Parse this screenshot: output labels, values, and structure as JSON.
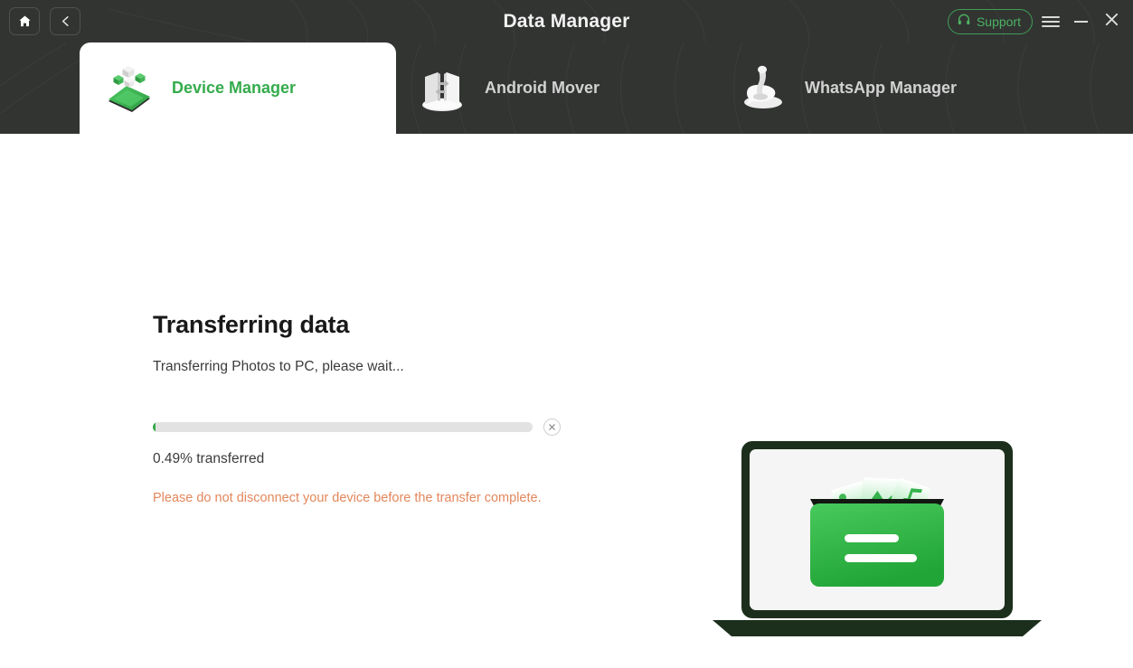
{
  "window": {
    "title": "Data Manager",
    "home_icon": "home-icon",
    "back_icon": "back-chevron-icon",
    "support_label": "Support",
    "support_icon": "headset-icon",
    "menu_icon": "hamburger-menu-icon",
    "minimize_icon": "minimize-icon",
    "close_icon": "close-icon",
    "titlebar_bg": "#323432",
    "accent_green": "#35ab4c"
  },
  "tabs": [
    {
      "label": "Device Manager",
      "icon": "phone-transfer-icon",
      "active": true
    },
    {
      "label": "Android Mover",
      "icon": "android-mover-icon",
      "active": false
    },
    {
      "label": "WhatsApp Manager",
      "icon": "whatsapp-manager-icon",
      "active": false
    }
  ],
  "main": {
    "title": "Transferring data",
    "subtitle": "Transferring Photos to PC, please wait...",
    "progress_percent": 0.49,
    "progress_text": "0.49% transferred",
    "warning": "Please do not disconnect your device before the transfer complete.",
    "warning_color": "#e3875c",
    "progress_fill_color": "#33a84a",
    "progress_track_color": "#e2e2e2",
    "cancel_icon": "close-circle-icon",
    "illustration": "laptop-with-media-folder-icon"
  }
}
